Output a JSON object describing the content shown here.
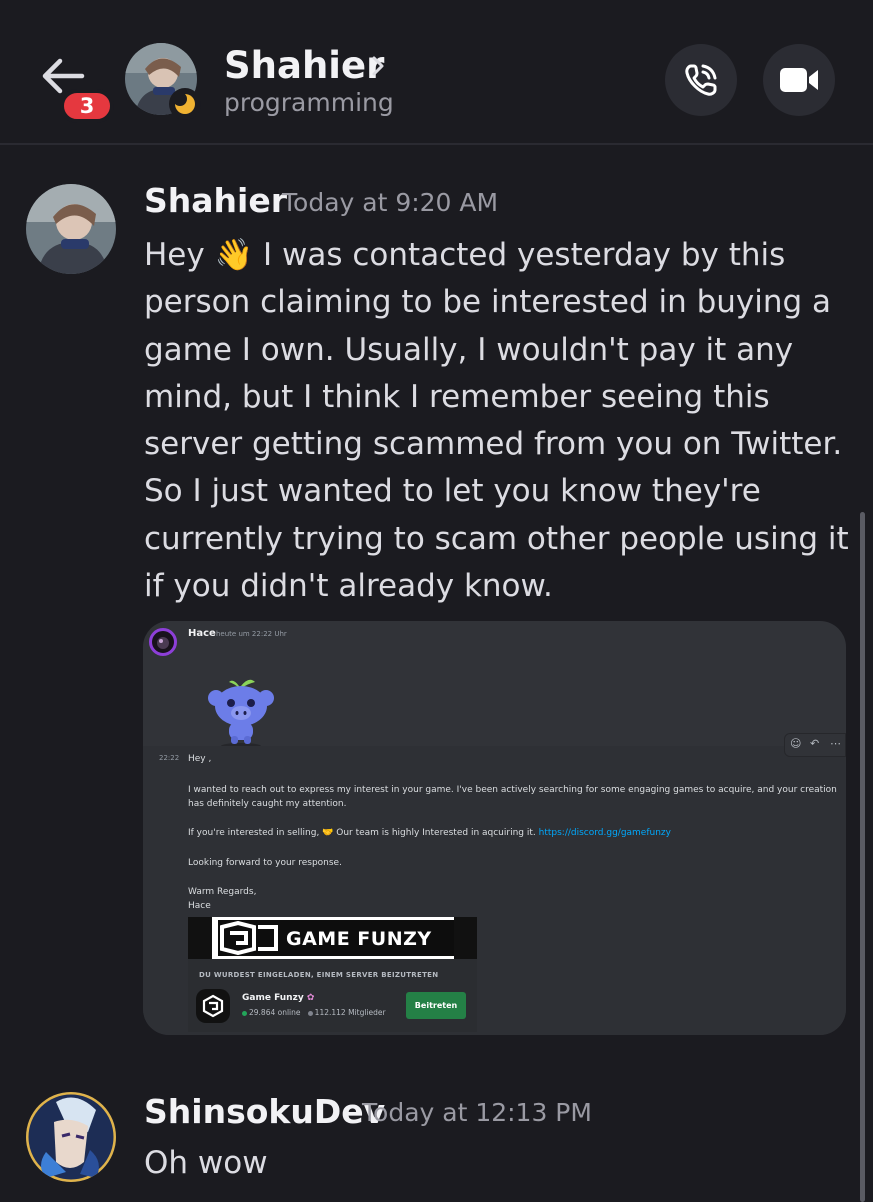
{
  "header": {
    "unread_count": "3",
    "channel_name": "Shahier",
    "channel_subtitle": "programming",
    "icons": [
      "back-arrow-icon",
      "chevron-right-icon",
      "moon-status-icon",
      "phone-call-icon",
      "video-camera-icon"
    ]
  },
  "messages": [
    {
      "author": "Shahier",
      "timestamp": "Today at 9:20 AM",
      "text": "Hey 👋 I was contacted yesterday by this person claiming to be interested in buying a game I own. Usually, I wouldn't pay it any mind, but I think I remember seeing this server getting scammed from you on Twitter. So I just wanted to let you know they're currently trying to scam other people using it if you didn't already know."
    },
    {
      "author": "ShinsokuDev",
      "timestamp": "Today at 12:13 PM",
      "text": "Oh wow"
    }
  ],
  "attachment": {
    "author": "Hace",
    "timestamp": "heute um 22:22 Uhr",
    "line_time": "22:22",
    "greeting": "Hey ,",
    "para1": "I wanted to reach out to express my interest in your game. I've been actively searching for some engaging games to acquire, and your creation has definitely caught my attention.",
    "para2_prefix": "If you're interested in selling, 🤝 Our team is highly Interested in aqcuiring it. ",
    "para2_link": "https://discord.gg/gamefunzy",
    "para3": "Looking forward to your response.",
    "signoff": "Warm Regards,\nHace",
    "banner_text": "GAME FUNZY",
    "invite": {
      "heading": "DU WURDEST EINGELADEN, EINEM SERVER BEIZUTRETEN",
      "server_name": "Game Funzy",
      "online": "29.864 online",
      "members": "112.112 Mitglieder",
      "join_label": "Beitreten"
    }
  },
  "colors": {
    "background": "#1b1b20",
    "badge_red": "#e5383f",
    "link_blue": "#00a8fc",
    "join_green": "#248046",
    "online_green": "#23a55a"
  }
}
